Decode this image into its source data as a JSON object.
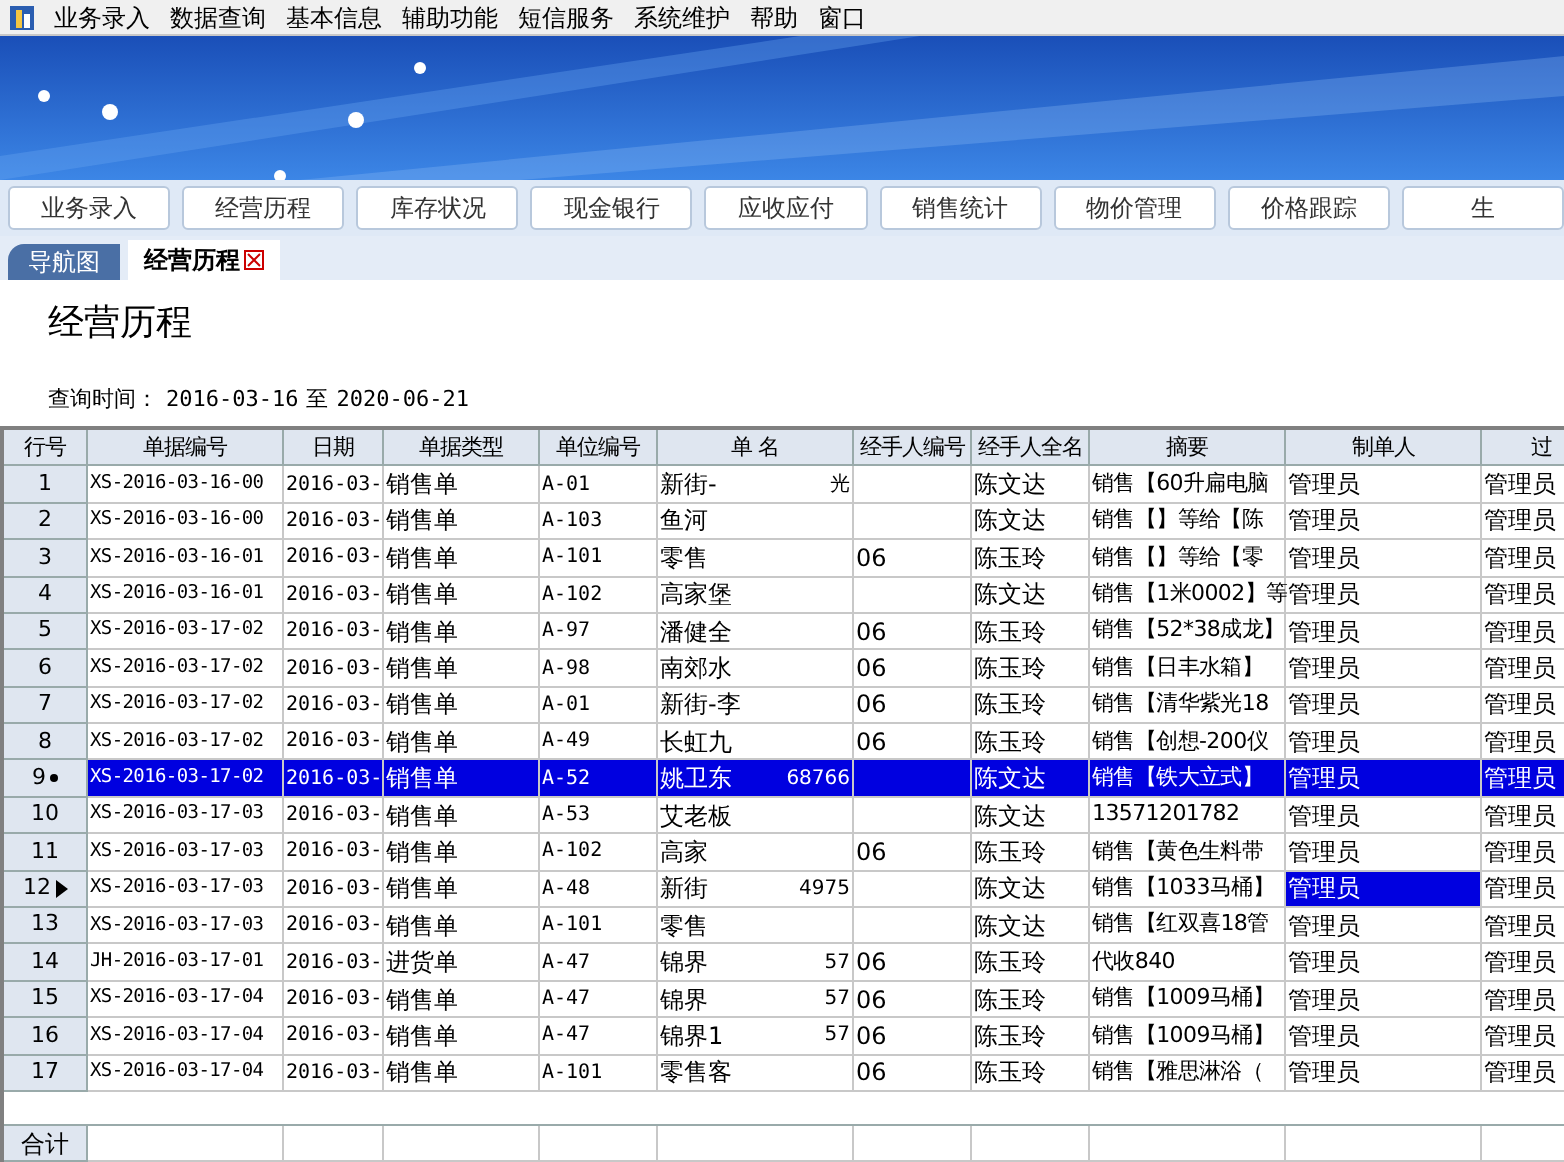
{
  "menu": [
    "业务录入",
    "数据查询",
    "基本信息",
    "辅助功能",
    "短信服务",
    "系统维护",
    "帮助",
    "窗口"
  ],
  "toolbar": [
    "业务录入",
    "经营历程",
    "库存状况",
    "现金银行",
    "应收应付",
    "销售统计",
    "物价管理",
    "价格跟踪",
    "生"
  ],
  "tabs": [
    {
      "label": "导航图",
      "selected": false,
      "closable": false
    },
    {
      "label": "经营历程",
      "selected": true,
      "closable": true
    }
  ],
  "page_title": "经营历程",
  "query": {
    "label": "查询时间：",
    "from": "2016-03-16",
    "sep": "至",
    "to": "2020-06-21"
  },
  "table": {
    "columns": [
      "行号",
      "单据编号",
      "日期",
      "单据类型",
      "单位编号",
      "单 名",
      "经手人编号",
      "经手人全名",
      "摘要",
      "制单人",
      "过"
    ],
    "rows": [
      {
        "cells": [
          "1",
          "XS-2016-03-16-00",
          "2016-03-",
          "销售单",
          "A-01",
          "新街-",
          "",
          "陈文达",
          "销售【60升扁电脑",
          "管理员",
          "管理员"
        ],
        "tail": "光",
        "selected": false,
        "current": false
      },
      {
        "cells": [
          "2",
          "XS-2016-03-16-00",
          "2016-03-",
          "销售单",
          "A-103",
          "鱼河",
          "",
          "陈文达",
          "销售【】等给【陈",
          "管理员",
          "管理员"
        ],
        "tail": "",
        "selected": false,
        "current": false
      },
      {
        "cells": [
          "3",
          "XS-2016-03-16-01",
          "2016-03-",
          "销售单",
          "A-101",
          "零售",
          "06",
          "陈玉玲",
          "销售【】等给【零",
          "管理员",
          "管理员"
        ],
        "tail": "",
        "selected": false,
        "current": false
      },
      {
        "cells": [
          "4",
          "XS-2016-03-16-01",
          "2016-03-",
          "销售单",
          "A-102",
          "高家堡",
          "",
          "陈文达",
          "销售【1米0002】等",
          "管理员",
          "管理员"
        ],
        "tail": "",
        "selected": false,
        "current": false
      },
      {
        "cells": [
          "5",
          "XS-2016-03-17-02",
          "2016-03-",
          "销售单",
          "A-97",
          "潘健全",
          "06",
          "陈玉玲",
          "销售【52*38成龙】",
          "管理员",
          "管理员"
        ],
        "tail": "",
        "selected": false,
        "current": false
      },
      {
        "cells": [
          "6",
          "XS-2016-03-17-02",
          "2016-03-",
          "销售单",
          "A-98",
          "南郊水",
          "06",
          "陈玉玲",
          "销售【日丰水箱】",
          "管理员",
          "管理员"
        ],
        "tail": "",
        "selected": false,
        "current": false
      },
      {
        "cells": [
          "7",
          "XS-2016-03-17-02",
          "2016-03-",
          "销售单",
          "A-01",
          "新街-李",
          "06",
          "陈玉玲",
          "销售【清华紫光18",
          "管理员",
          "管理员"
        ],
        "tail": "",
        "selected": false,
        "current": false
      },
      {
        "cells": [
          "8",
          "XS-2016-03-17-02",
          "2016-03-",
          "销售单",
          "A-49",
          "长虹九",
          "06",
          "陈玉玲",
          "销售【创想-200仪",
          "管理员",
          "管理员"
        ],
        "tail": "",
        "selected": false,
        "current": false
      },
      {
        "cells": [
          "9",
          "XS-2016-03-17-02",
          "2016-03-",
          "销售单",
          "A-52",
          "姚卫东",
          "",
          "陈文达",
          "销售【铁大立式】",
          "管理员",
          "管理员"
        ],
        "tail": "68766",
        "selected": true,
        "current": false
      },
      {
        "cells": [
          "10",
          "XS-2016-03-17-03",
          "2016-03-",
          "销售单",
          "A-53",
          "艾老板",
          "",
          "陈文达",
          "13571201782",
          "管理员",
          "管理员"
        ],
        "tail": "",
        "selected": false,
        "current": false
      },
      {
        "cells": [
          "11",
          "XS-2016-03-17-03",
          "2016-03-",
          "销售单",
          "A-102",
          "高家",
          "06",
          "陈玉玲",
          "销售【黄色生料带",
          "管理员",
          "管理员"
        ],
        "tail": "",
        "selected": false,
        "current": false
      },
      {
        "cells": [
          "12",
          "XS-2016-03-17-03",
          "2016-03-",
          "销售单",
          "A-48",
          "新街",
          "",
          "陈文达",
          "销售【1033马桶】",
          "管理员",
          "管理员"
        ],
        "tail": "4975",
        "selected": false,
        "current": true
      },
      {
        "cells": [
          "13",
          "XS-2016-03-17-03",
          "2016-03-",
          "销售单",
          "A-101",
          "零售",
          "",
          "陈文达",
          "销售【红双喜18管",
          "管理员",
          "管理员"
        ],
        "tail": "",
        "selected": false,
        "current": false
      },
      {
        "cells": [
          "14",
          "JH-2016-03-17-01",
          "2016-03-",
          "进货单",
          "A-47",
          "锦界",
          "06",
          "陈玉玲",
          "代收840",
          "管理员",
          "管理员"
        ],
        "tail": "57",
        "selected": false,
        "current": false
      },
      {
        "cells": [
          "15",
          "XS-2016-03-17-04",
          "2016-03-",
          "销售单",
          "A-47",
          "锦界",
          "06",
          "陈玉玲",
          "销售【1009马桶】",
          "管理员",
          "管理员"
        ],
        "tail": "57",
        "selected": false,
        "current": false
      },
      {
        "cells": [
          "16",
          "XS-2016-03-17-04",
          "2016-03-",
          "销售单",
          "A-47",
          "锦界1",
          "06",
          "陈玉玲",
          "销售【1009马桶】",
          "管理员",
          "管理员"
        ],
        "tail": "57",
        "selected": false,
        "current": false
      },
      {
        "cells": [
          "17",
          "XS-2016-03-17-04",
          "2016-03-",
          "销售单",
          "A-101",
          "零售客",
          "06",
          "陈玉玲",
          "销售【雅思淋浴（",
          "管理员",
          "管理员"
        ],
        "tail": "",
        "selected": false,
        "current": false
      }
    ],
    "total_label": "合计"
  }
}
